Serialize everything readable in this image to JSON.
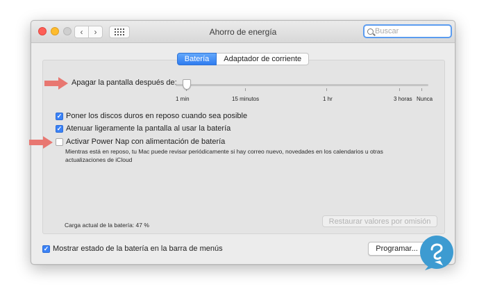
{
  "window": {
    "title": "Ahorro de energía"
  },
  "search": {
    "placeholder": "Buscar"
  },
  "tabs": [
    {
      "label": "Batería",
      "active": true
    },
    {
      "label": "Adaptador de corriente",
      "active": false
    }
  ],
  "slider": {
    "label": "Apagar la pantalla después de:",
    "ticks": [
      "1 min",
      "15 minutos",
      "1 hr",
      "3 horas",
      "Nunca"
    ],
    "value": "1 min"
  },
  "options": [
    {
      "label": "Poner los discos duros en reposo cuando sea posible",
      "checked": true
    },
    {
      "label": "Atenuar ligeramente la pantalla al usar la batería",
      "checked": true
    },
    {
      "label": "Activar Power Nap con alimentación de batería",
      "checked": false
    }
  ],
  "power_nap_description": "Mientras está en reposo, tu Mac puede revisar periódicamente si hay correo nuevo, novedades en los calendarios u otras actualizaciones de iCloud",
  "battery_level": "Carga actual de la batería: 47 %",
  "buttons": {
    "restore": "Restaurar valores por omisión",
    "schedule": "Programar..."
  },
  "menu_bar_option": {
    "label": "Mostrar estado de la batería en la barra de menús",
    "checked": true
  },
  "colors": {
    "accent": "#3b82f6",
    "annotation_arrow": "#e87771",
    "logo": "#3d9bd1"
  }
}
